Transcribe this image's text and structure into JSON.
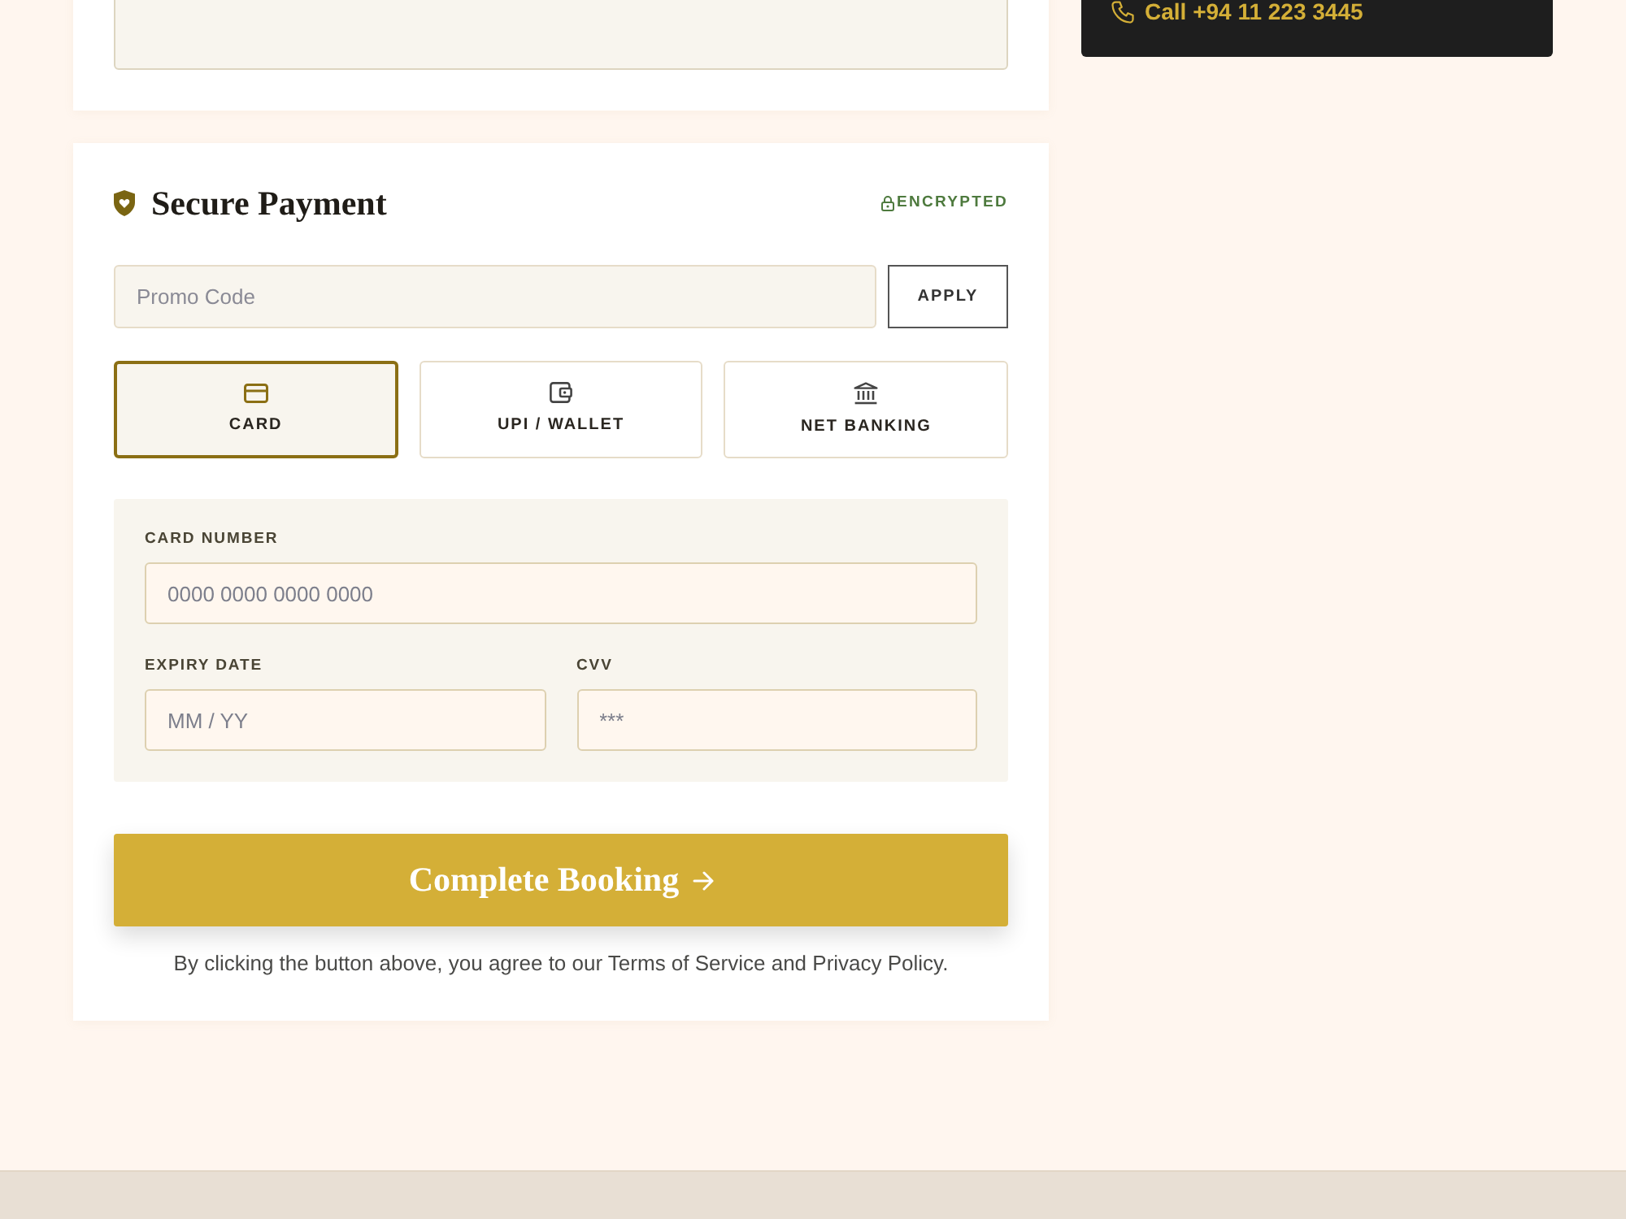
{
  "contact_card": {
    "phone": "Call +94 11 223 3445"
  },
  "payment": {
    "title": "Secure Payment",
    "badge": "ENCRYPTED",
    "promo": {
      "placeholder": "Promo Code",
      "button": "APPLY"
    },
    "methods": [
      {
        "kind": "card",
        "label": "CARD",
        "selected": true
      },
      {
        "kind": "wallet",
        "label": "UPI / WALLET",
        "selected": false
      },
      {
        "kind": "bank",
        "label": "NET BANKING",
        "selected": false
      }
    ],
    "card_form": {
      "rows": [
        {
          "fields": [
            {
              "label": "CARD NUMBER",
              "placeholder": "0000 0000 0000 0000"
            }
          ]
        },
        {
          "fields": [
            {
              "label": "EXPIRY DATE",
              "placeholder": "MM / YY"
            },
            {
              "label": "CVV",
              "placeholder": "***"
            }
          ]
        }
      ]
    },
    "submit": "Complete Booking",
    "terms": "By clicking the button above, you agree to our Terms of Service and Privacy Policy."
  }
}
